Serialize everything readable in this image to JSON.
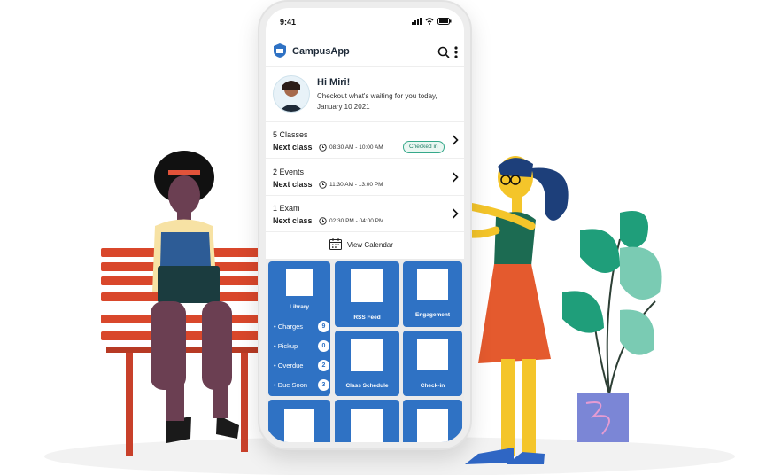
{
  "status_bar": {
    "time": "9:41"
  },
  "app": {
    "title": "CampusApp"
  },
  "greeting": {
    "hi": "Hi Miri!",
    "message": "Checkout what's waiting for you today, January 10 2021"
  },
  "schedule": [
    {
      "title": "5 Classes",
      "next_label": "Next class",
      "time": "08:30 AM - 10:00 AM",
      "badge": "Checked in"
    },
    {
      "title": "2 Events",
      "next_label": "Next class",
      "time": "11:30 AM - 13:00 PM"
    },
    {
      "title": "1 Exam",
      "next_label": "Next class",
      "time": "02:30 PM - 04:00 PM"
    }
  ],
  "calendar": {
    "label": "View Calendar"
  },
  "tiles": {
    "library": {
      "label": "Library",
      "items": [
        {
          "label": "• Charges",
          "count": "9"
        },
        {
          "label": "• Pickup",
          "count": "0"
        },
        {
          "label": "• Overdue",
          "count": "2"
        },
        {
          "label": "• Due Soon",
          "count": "3"
        }
      ]
    },
    "rss": "RSS Feed",
    "engagement": "Engagement",
    "class_schedule": "Class Schedule",
    "checkin": "Check-in"
  },
  "colors": {
    "accent": "#2f72c4",
    "badge": "#35a88a",
    "bench": "#d9472b",
    "plant": "#5ec4a4"
  }
}
